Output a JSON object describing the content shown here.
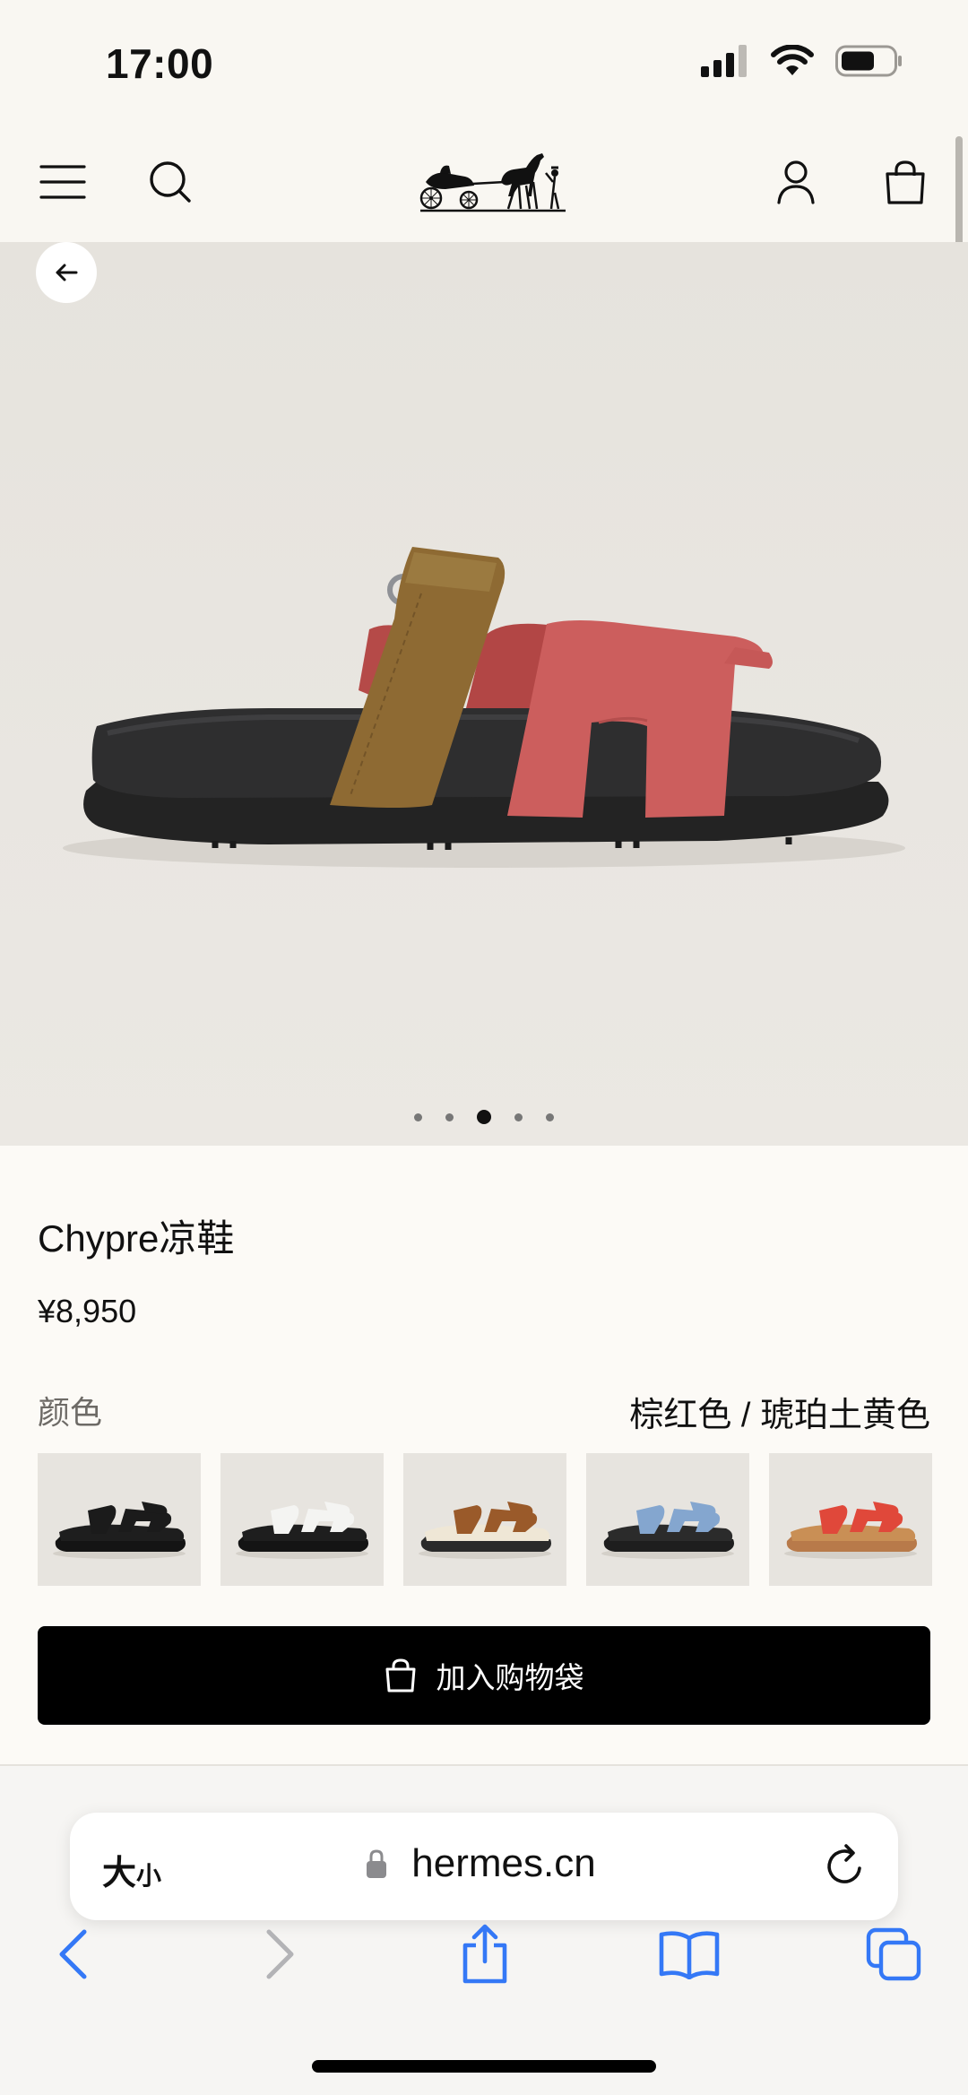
{
  "status_bar": {
    "time": "17:00"
  },
  "header": {
    "menu_icon": "hamburger-menu-icon",
    "search_icon": "search-icon",
    "logo_icon": "hermes-carriage-logo",
    "account_icon": "user-account-icon",
    "bag_icon": "shopping-bag-icon"
  },
  "hero": {
    "back_icon": "arrow-left-icon",
    "pager": {
      "count": 5,
      "active_index": 2
    }
  },
  "product": {
    "title": "Chypre凉鞋",
    "price": "¥8,950",
    "color_label": "颜色",
    "color_value": "棕红色 / 琥珀土黄色",
    "swatches": [
      {
        "strap": "#1b1b1b",
        "sole": "#141414",
        "footbed": "#1e1e1e"
      },
      {
        "strap": "#f4f4f2",
        "sole": "#141414",
        "footbed": "#1e1e1e"
      },
      {
        "strap": "#9a5a2a",
        "sole": "#2a2a2a",
        "footbed": "#efe7d6"
      },
      {
        "strap": "#84a6cf",
        "sole": "#1e1e1e",
        "footbed": "#2b2b2b"
      },
      {
        "strap": "#e0483a",
        "sole": "#b87a4a",
        "footbed": "#c98f55"
      }
    ],
    "add_to_cart": "加入购物袋"
  },
  "browser": {
    "text_size_label": "大",
    "text_size_small": "小",
    "domain": "hermes.cn",
    "accent_color": "#3478f6"
  }
}
